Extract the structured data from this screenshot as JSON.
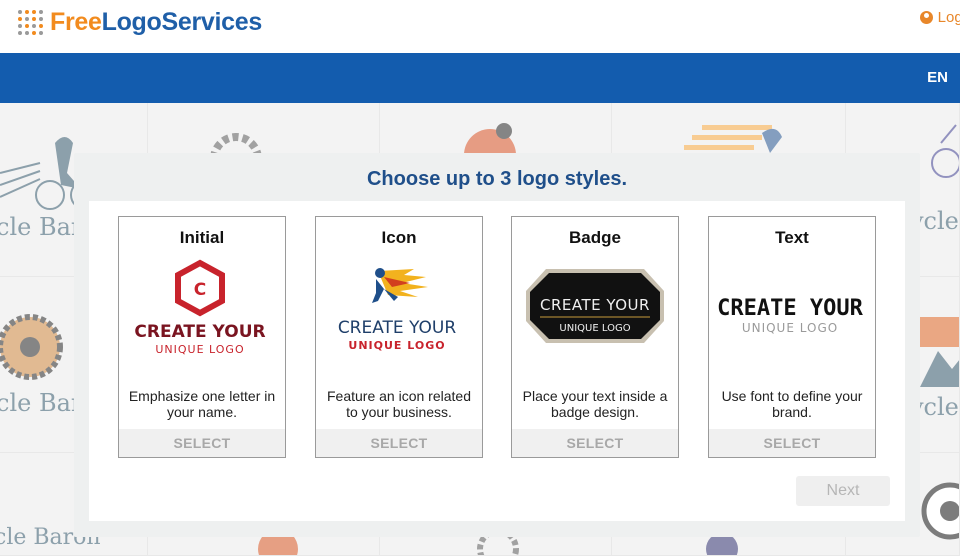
{
  "header": {
    "logo_free": "Free",
    "logo_rest": "LogoServices",
    "login_label": "Logi"
  },
  "nav": {
    "language": "EN"
  },
  "background": {
    "brand_text": "cle Baron",
    "brand_text_alt": "ycle"
  },
  "modal": {
    "title": "Choose up to 3 logo styles.",
    "cards": [
      {
        "title": "Initial",
        "letter": "C",
        "line1": "CREATE YOUR",
        "line2": "UNIQUE LOGO",
        "description": "Emphasize one letter in your name.",
        "select_label": "SELECT"
      },
      {
        "title": "Icon",
        "line1": "CREATE YOUR",
        "line2": "UNIQUE LOGO",
        "description": "Feature an icon related to your business.",
        "select_label": "SELECT"
      },
      {
        "title": "Badge",
        "line1": "CREATE YOUR",
        "line2": "UNIQUE LOGO",
        "description": "Place your text inside a badge design.",
        "select_label": "SELECT"
      },
      {
        "title": "Text",
        "line1": "CREATE YOUR",
        "line2": "UNIQUE LOGO",
        "description": "Use font to define your brand.",
        "select_label": "SELECT"
      }
    ],
    "next_label": "Next"
  },
  "colors": {
    "brand_blue": "#135cae",
    "title_blue": "#1f4f8a",
    "accent_orange": "#f28b1e",
    "initial_red": "#c8232c"
  }
}
